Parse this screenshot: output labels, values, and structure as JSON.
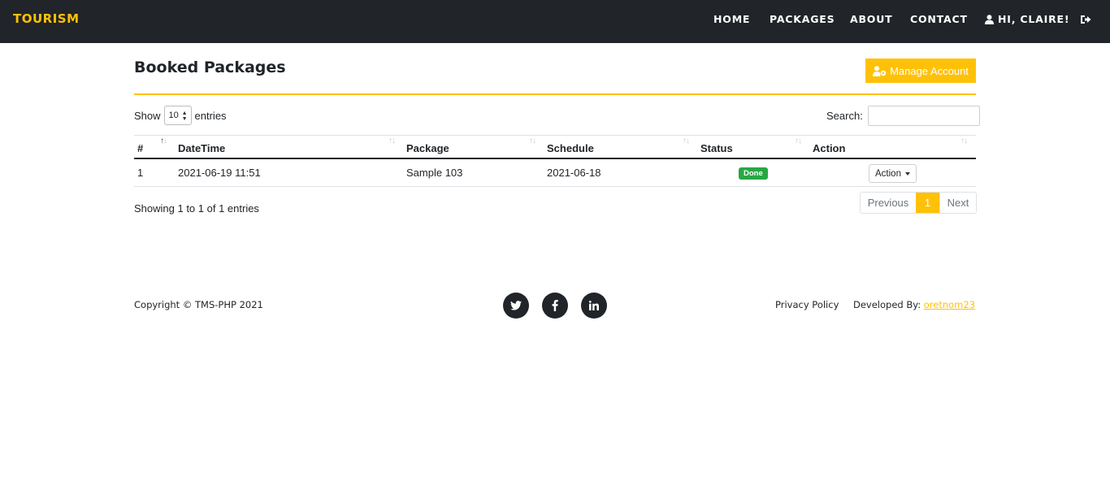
{
  "navbar": {
    "brand": "TOURISM",
    "links": [
      "HOME",
      "PACKAGES",
      "ABOUT",
      "CONTACT"
    ],
    "user": "HI, CLAIRE!",
    "icons": {
      "user": "user-icon",
      "logout": "logout-icon"
    },
    "accent_color": "#ffc107",
    "background_color": "#212529"
  },
  "page": {
    "title": "Booked Packages",
    "manage_button": "Manage Account"
  },
  "table_controls": {
    "show_label": "Show",
    "page_length": "10",
    "entries_label": "entries",
    "search_label": "Search:",
    "search_value": ""
  },
  "table": {
    "columns": [
      "#",
      "DateTime",
      "Package",
      "Schedule",
      "Status",
      "Action"
    ],
    "rows": [
      {
        "num": "1",
        "datetime": "2021-06-19 11:51",
        "package": "Sample 103",
        "schedule": "2021-06-18",
        "status": "Done",
        "action": "Action"
      }
    ],
    "status_color": "#28a745"
  },
  "pagination": {
    "info": "Showing 1 to 1 of 1 entries",
    "previous": "Previous",
    "current": "1",
    "next": "Next"
  },
  "footer": {
    "copyright": "Copyright © TMS-PHP 2021",
    "social": [
      "twitter-icon",
      "facebook-icon",
      "linkedin-icon"
    ],
    "privacy": "Privacy Policy",
    "developed_by_label": "Developed By:",
    "developer": "oretnom23"
  }
}
